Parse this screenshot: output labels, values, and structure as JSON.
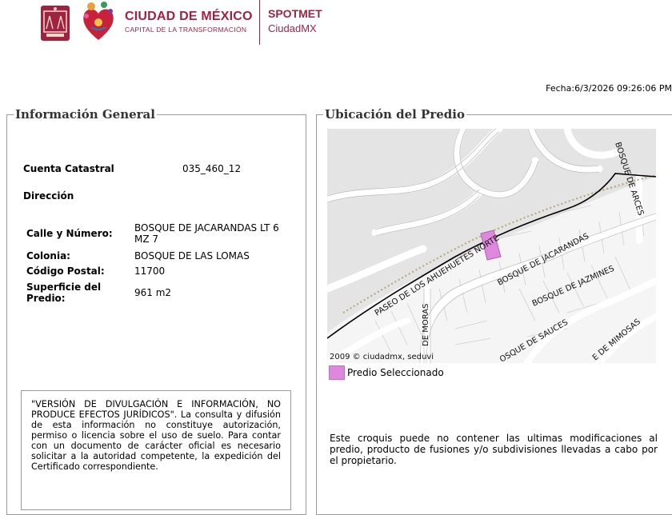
{
  "header": {
    "brand_title": "CIUDAD DE MÉXICO",
    "brand_subtitle": "CAPITAL DE LA TRANSFORMACIÓN",
    "app_name": "SPOTMET",
    "app_sub": "CiudadMX",
    "colors": {
      "brand": "#9f2241"
    }
  },
  "fecha": "Fecha:6/3/2026 09:26:06 PM",
  "info": {
    "legend": "Información General",
    "cuenta_label": "Cuenta Catastral",
    "cuenta_value": "035_460_12",
    "direccion_label": "Dirección",
    "calle_label": "Calle y Número:",
    "calle_value": "BOSQUE DE JACARANDAS LT 6 MZ 7",
    "colonia_label": "Colonia:",
    "colonia_value": "BOSQUE DE LAS LOMAS",
    "cp_label": "Código Postal:",
    "cp_value": "11700",
    "superficie_label": "Superficie del Predio:",
    "superficie_value": "961 m2",
    "notice": "\"VERSIÓN DE DIVULGACIÓN E INFORMACIÓN, NO PRODUCE EFECTOS JURÍDICOS\". La consulta y difusión de esta información no constituye autorización, permiso o licencia sobre el uso de suelo. Para contar con un documento de carácter oficial es necesario solicitar a la autoridad competente, la expedición del Certificado correspondiente."
  },
  "ubicacion": {
    "legend": "Ubicación del Predio",
    "map_credit": "2009 © ciudadmx, seduvi",
    "streets": {
      "arces": "BOSQUE DE ARCES",
      "ahuehuetes": "PASEO DE LOS AHUEHUETES NORTE",
      "jacarandas": "BOSQUE DE JACARANDAS",
      "jazmines": "BOSQUE DE JAZMINES",
      "moras": "DE MORAS",
      "sauces": "OSQUE DE SAUCES",
      "mimosas": "E DE MIMOSAS"
    },
    "legend_label": "Predio Seleccionado",
    "legend_color": "#dd88dd",
    "croquis_note": "Este croquis puede no contener las ultimas modificaciones al predio, producto de fusiones y/o subdivisiones llevadas a cabo por el propietario."
  }
}
